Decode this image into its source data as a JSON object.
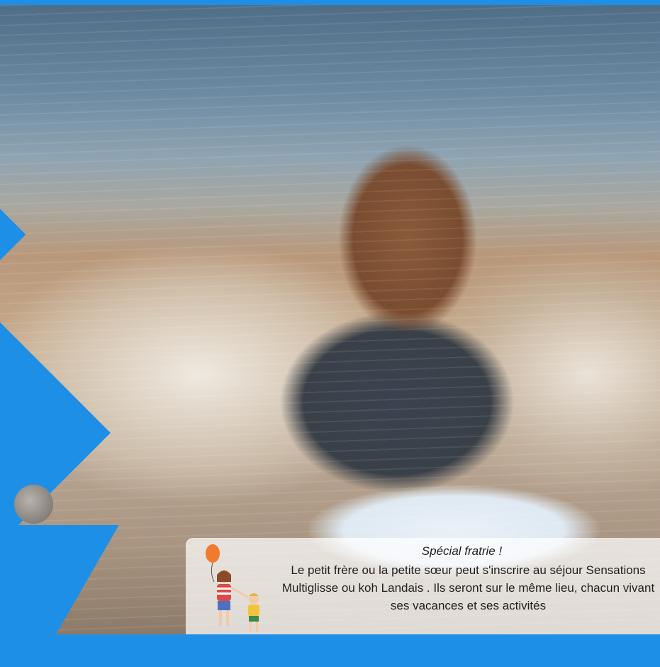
{
  "hero": {
    "image_alt_icon": "girl-bodyboarding-photo"
  },
  "sibling_notice": {
    "heading": "Spécial fratrie !",
    "body": "Le petit frère ou la petite sœur peut s'inscrire au séjour Sensations Multiglisse ou koh Landais . Ils seront sur le même lieu, chacun vivant ses vacances et ses activités",
    "illustration_icon": "siblings-balloon-illustration"
  },
  "colors": {
    "brand_blue": "#1e8fe6",
    "balloon": "#f07a2e"
  }
}
